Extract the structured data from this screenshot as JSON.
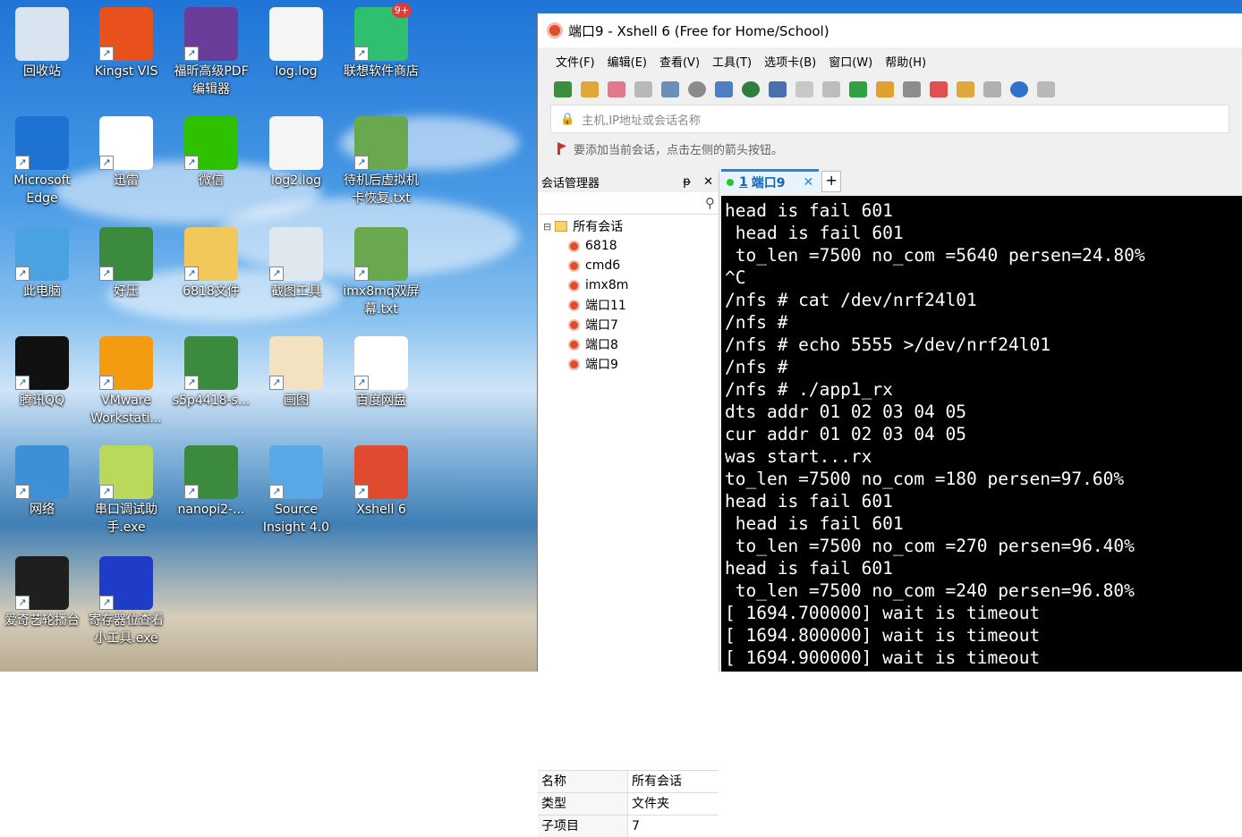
{
  "desktop": {
    "icons": [
      {
        "label": "回收站",
        "icon": "recycle-bin-icon",
        "color": "#d8e4f0"
      },
      {
        "label": "Kingst VIS",
        "icon": "kingst-vis-icon",
        "color": "#e8501c"
      },
      {
        "label": "福昕高级PDF编辑器",
        "icon": "foxit-pdf-icon",
        "color": "#6a3d9a"
      },
      {
        "label": "log.log",
        "icon": "text-file-icon",
        "color": "#f5f5f5"
      },
      {
        "label": "联想软件商店",
        "icon": "lenovo-store-icon",
        "color": "#2fbf71"
      },
      {
        "label": "Microsoft Edge",
        "icon": "edge-icon",
        "color": "#1e73d2"
      },
      {
        "label": "迅雷",
        "icon": "xunlei-icon",
        "color": "#ffffff"
      },
      {
        "label": "微信",
        "icon": "wechat-icon",
        "color": "#2dc100"
      },
      {
        "label": "log2.log",
        "icon": "text-file-icon",
        "color": "#f5f5f5"
      },
      {
        "label": "待机后虚拟机卡恢复.txt",
        "icon": "notepad-icon",
        "color": "#6aa84f"
      },
      {
        "label": "此电脑",
        "icon": "computer-icon",
        "color": "#4aa3e0"
      },
      {
        "label": "好压",
        "icon": "haozip-icon",
        "color": "#3b8a3e"
      },
      {
        "label": "6818文件",
        "icon": "folder-icon",
        "color": "#f2c85b"
      },
      {
        "label": "截图工具",
        "icon": "snipping-tool-icon",
        "color": "#dfe7ef"
      },
      {
        "label": "imx8mq双屏幕.txt",
        "icon": "notepad-icon",
        "color": "#6aa84f"
      },
      {
        "label": "腾讯QQ",
        "icon": "qq-icon",
        "color": "#111111"
      },
      {
        "label": "VMware Workstati...",
        "icon": "vmware-icon",
        "color": "#f39c12"
      },
      {
        "label": "s5p4418-s...",
        "icon": "archive-icon",
        "color": "#3b8a3e"
      },
      {
        "label": "画图",
        "icon": "paint-icon",
        "color": "#f2e2c2"
      },
      {
        "label": "百度网盘",
        "icon": "baidu-netdisk-icon",
        "color": "#ffffff"
      },
      {
        "label": "网络",
        "icon": "network-icon",
        "color": "#3d8fd6"
      },
      {
        "label": "串口调试助手.exe",
        "icon": "serial-tool-icon",
        "color": "#b8d95a"
      },
      {
        "label": "nanopi2-...",
        "icon": "archive-icon",
        "color": "#3b8a3e"
      },
      {
        "label": "Source Insight 4.0",
        "icon": "source-insight-icon",
        "color": "#5aa9e6"
      },
      {
        "label": "Xshell 6",
        "icon": "xshell-icon",
        "color": "#e04a2f"
      },
      {
        "label": "爱奇艺轮播台",
        "icon": "iqiyi-icon",
        "color": "#1f1f1f"
      },
      {
        "label": "寄存器位查看小工具.exe",
        "icon": "register-tool-icon",
        "color": "#1e3cc8"
      }
    ],
    "store_badge": "9+"
  },
  "window": {
    "title": "端口9 - Xshell 6 (Free for Home/School)",
    "menu": [
      "文件(F)",
      "编辑(E)",
      "查看(V)",
      "工具(T)",
      "选项卡(B)",
      "窗口(W)",
      "帮助(H)"
    ],
    "address_placeholder": "主机,IP地址或会话名称",
    "hint": "要添加当前会话，点击左侧的箭头按钮。"
  },
  "sessions": {
    "title": "会话管理器",
    "pin": "ᵽ",
    "close": "✕",
    "root": "所有会话",
    "items": [
      "6818",
      "cmd6",
      "imx8m",
      "端口11",
      "端口7",
      "端口8",
      "端口9"
    ]
  },
  "properties": [
    {
      "key": "名称",
      "value": "所有会话"
    },
    {
      "key": "类型",
      "value": "文件夹"
    },
    {
      "key": "子项目",
      "value": "7"
    }
  ],
  "tab": {
    "number": "1",
    "label": "端口9",
    "close": "✕",
    "add": "+"
  },
  "terminal": {
    "lines": [
      "head is fail 601",
      " head is fail 601",
      " to_len =7500 no_com =5640 persen=24.80%",
      "^C",
      "/nfs # cat /dev/nrf24l01",
      "/nfs #",
      "/nfs # echo 5555 >/dev/nrf24l01",
      "/nfs #",
      "/nfs # ./app1_rx",
      "dts addr 01 02 03 04 05",
      "cur addr 01 02 03 04 05",
      "was start...rx",
      "to_len =7500 no_com =180 persen=97.60%",
      "head is fail 601",
      " head is fail 601",
      " to_len =7500 no_com =270 persen=96.40%",
      "head is fail 601",
      " to_len =7500 no_com =240 persen=96.80%",
      "[ 1694.700000] wait is timeout",
      "[ 1694.800000] wait is timeout",
      "[ 1694.900000] wait is timeout"
    ]
  }
}
